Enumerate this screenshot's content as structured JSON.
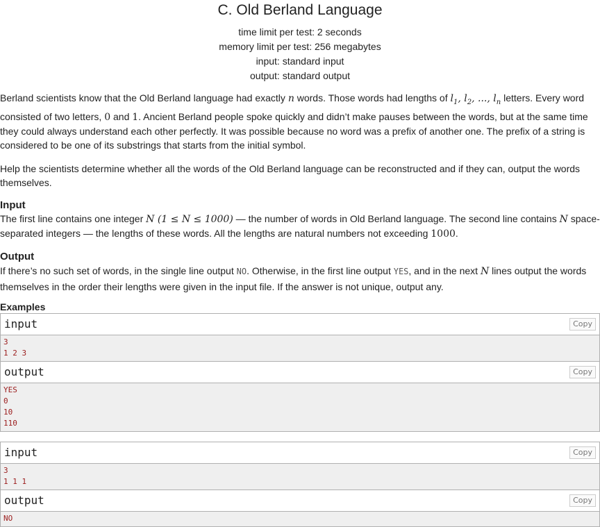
{
  "problem": {
    "title": "C. Old Berland Language",
    "time_limit": "time limit per test: 2 seconds",
    "memory_limit": "memory limit per test: 256 megabytes",
    "input_file": "input: standard input",
    "output_file": "output: standard output"
  },
  "statement": {
    "p1_a": "Berland scientists know that the Old Berland language had exactly ",
    "p1_n": "n",
    "p1_b": " words. Those words had lengths of ",
    "p1_lengths": "l",
    "p1_c": " letters. Every word consisted of two letters, ",
    "p1_zero": "0",
    "p1_and": " and ",
    "p1_one": "1",
    "p1_d": ". Ancient Berland people spoke quickly and didn’t make pauses between the words, but at the same time they could always understand each other perfectly. It was possible because no word was a prefix of another one. The prefix of a string is considered to be one of its substrings that starts from the initial symbol.",
    "p2": "Help the scientists determine whether all the words of the Old Berland language can be reconstructed and if they can, output the words themselves."
  },
  "input_section": {
    "legend": "Input",
    "a": "The first line contains one integer ",
    "constraint": "N (1 ≤ N ≤ 1000)",
    "b": " — the number of words in Old Berland language. The second line contains ",
    "n": "N",
    "c": " space-separated integers — the lengths of these words. All the lengths are natural numbers not exceeding ",
    "limit": "1000",
    "d": "."
  },
  "output_section": {
    "legend": "Output",
    "a": "If there’s no such set of words, in the single line output ",
    "no": "NO",
    "b": ". Otherwise, in the first line output ",
    "yes": "YES",
    "c": ", and in the next ",
    "n": "N",
    "d": " lines output the words themselves in the order their lengths were given in the input file. If the answer is not unique, output any."
  },
  "examples": {
    "title": "Examples",
    "copy_label": "Copy",
    "input_label": "input",
    "output_label": "output",
    "ex1": {
      "input": [
        "3",
        "1 2 3"
      ],
      "output": [
        "YES",
        "0",
        "10",
        "110"
      ]
    },
    "ex2": {
      "input": [
        "3",
        "1 1 1"
      ],
      "output": [
        "NO"
      ]
    }
  }
}
